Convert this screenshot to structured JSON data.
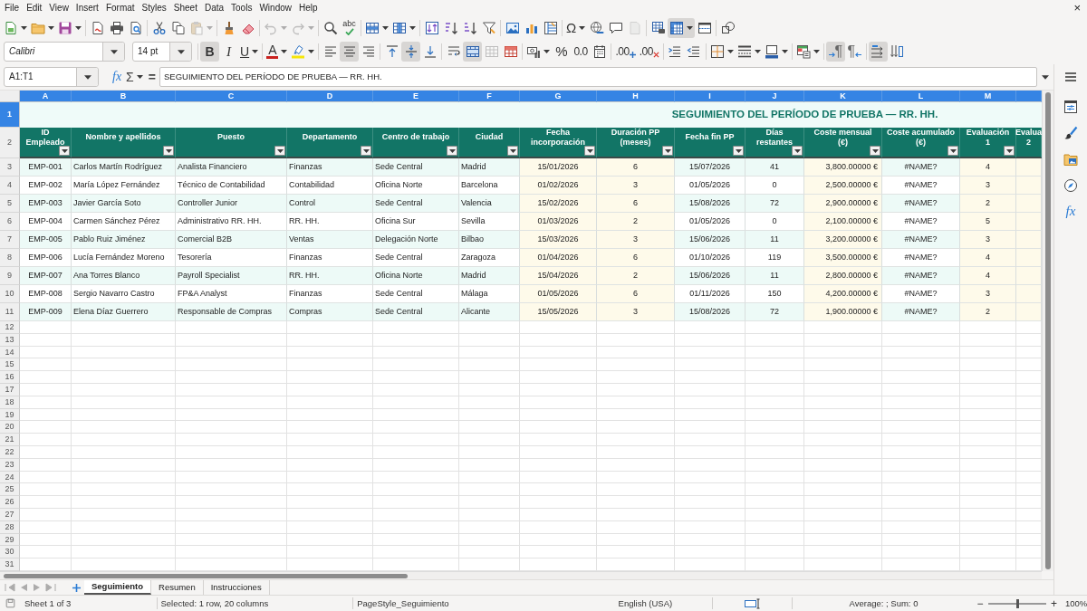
{
  "menu": [
    "File",
    "Edit",
    "View",
    "Insert",
    "Format",
    "Styles",
    "Sheet",
    "Data",
    "Tools",
    "Window",
    "Help"
  ],
  "close_document": "×",
  "standard_toolbar": {
    "paste": {
      "disabled": true
    },
    "undo": {
      "disabled": true
    },
    "redo": {
      "disabled": true
    },
    "spelling": {
      "label": "abc"
    },
    "special_character": {
      "label": "Ω"
    },
    "headers_footers": {
      "disabled": true
    },
    "freeze_panes": {
      "pressed": true
    }
  },
  "formatting_toolbar": {
    "font_name": "Calibri",
    "font_size": "14 pt",
    "bold": {
      "label": "B",
      "pressed": true
    },
    "italic": {
      "label": "I",
      "pressed": false
    },
    "underline": {
      "label": "U",
      "pressed": false
    },
    "font_color": {
      "label": "A"
    },
    "align_left": {
      "pressed": false
    },
    "align_center": {
      "pressed": true
    },
    "align_right": {
      "pressed": false
    },
    "align_top": {
      "pressed": false
    },
    "align_middle": {
      "pressed": true
    },
    "align_bottom": {
      "pressed": false
    },
    "wrap_text": {
      "pressed": false
    },
    "merge_and_center": {
      "pressed": true
    },
    "merge_cells": {
      "disabled": true
    },
    "percent": {
      "label": "%"
    },
    "standard_format": {
      "label": "0.0"
    },
    "add_decimal": {
      "label": ".00"
    },
    "delete_decimal": {
      "label": ".00"
    },
    "left_to_right": {
      "label": "¶",
      "pressed": true
    },
    "right_to_left": {
      "label": "¶",
      "pressed": false
    },
    "text_left_to_right": {
      "pressed": true
    },
    "text_vertical": {
      "pressed": false
    }
  },
  "formula_bar": {
    "name_box": "A1:T1",
    "function_wizard": "fx",
    "sum": "Σ",
    "formula": "=",
    "content": "SEGUIMIENTO DEL PERÍODO DE PRUEBA — RR. HH."
  },
  "sidebar": {
    "functions": "fx"
  },
  "sheet": {
    "columns": [
      {
        "letter": "A",
        "selected": true,
        "heading": "ID\nEmpleado",
        "kind": "key",
        "filter": true
      },
      {
        "letter": "B",
        "selected": true,
        "heading": "Nombre y apellidos",
        "kind": "text",
        "filter": true
      },
      {
        "letter": "C",
        "selected": true,
        "heading": "Puesto",
        "kind": "text",
        "filter": true
      },
      {
        "letter": "D",
        "selected": true,
        "heading": "Departamento",
        "kind": "text",
        "filter": true
      },
      {
        "letter": "E",
        "selected": true,
        "heading": "Centro de trabajo",
        "kind": "text",
        "filter": true
      },
      {
        "letter": "F",
        "selected": true,
        "heading": "Ciudad",
        "kind": "text",
        "filter": true
      },
      {
        "letter": "G",
        "selected": true,
        "heading": "Fecha\nincorporación",
        "kind": "input",
        "filter": true
      },
      {
        "letter": "H",
        "selected": true,
        "heading": "Duración PP\n(meses)",
        "kind": "input",
        "filter": true
      },
      {
        "letter": "I",
        "selected": true,
        "heading": "Fecha fin PP",
        "kind": "calc",
        "filter": true
      },
      {
        "letter": "J",
        "selected": true,
        "heading": "Días\nrestantes",
        "kind": "calc",
        "filter": true
      },
      {
        "letter": "K",
        "selected": true,
        "heading": "Coste mensual\n(€)",
        "kind": "money",
        "filter": true
      },
      {
        "letter": "L",
        "selected": true,
        "heading": "Coste acumulado\n(€)",
        "kind": "calc",
        "filter": true
      },
      {
        "letter": "M",
        "selected": true,
        "heading": "Evaluación\n1",
        "kind": "input",
        "filter": true
      },
      {
        "selected": true,
        "heading": "Evalua\n2",
        "kind": "input"
      }
    ],
    "title_row": {
      "number": "1",
      "selected": true,
      "title": "SEGUIMIENTO DEL PERÍODO DE PRUEBA — RR. HH."
    },
    "header_row": {
      "number": "2",
      "selected": false
    },
    "rows": [
      {
        "number": "3",
        "selected": false,
        "cells": [
          "EMP-001",
          "Carlos Martín Rodríguez",
          "Analista Financiero",
          "Finanzas",
          "Sede Central",
          "Madrid",
          "15/01/2026",
          "6",
          "15/07/2026",
          "41",
          "3,800.00000 €",
          "#NAME?",
          "4"
        ]
      },
      {
        "number": "4",
        "selected": false,
        "cells": [
          "EMP-002",
          "María López Fernández",
          "Técnico de Contabilidad",
          "Contabilidad",
          "Oficina Norte",
          "Barcelona",
          "01/02/2026",
          "3",
          "01/05/2026",
          "0",
          "2,500.00000 €",
          "#NAME?",
          "3"
        ]
      },
      {
        "number": "5",
        "selected": false,
        "cells": [
          "EMP-003",
          "Javier García Soto",
          "Controller Junior",
          "Control",
          "Sede Central",
          "Valencia",
          "15/02/2026",
          "6",
          "15/08/2026",
          "72",
          "2,900.00000 €",
          "#NAME?",
          "2"
        ]
      },
      {
        "number": "6",
        "selected": false,
        "cells": [
          "EMP-004",
          "Carmen Sánchez Pérez",
          "Administrativo RR. HH.",
          "RR. HH.",
          "Oficina Sur",
          "Sevilla",
          "01/03/2026",
          "2",
          "01/05/2026",
          "0",
          "2,100.00000 €",
          "#NAME?",
          "5"
        ]
      },
      {
        "number": "7",
        "selected": false,
        "cells": [
          "EMP-005",
          "Pablo Ruiz Jiménez",
          "Comercial B2B",
          "Ventas",
          "Delegación Norte",
          "Bilbao",
          "15/03/2026",
          "3",
          "15/06/2026",
          "11",
          "3,200.00000 €",
          "#NAME?",
          "3"
        ]
      },
      {
        "number": "8",
        "selected": false,
        "cells": [
          "EMP-006",
          "Lucía Fernández Moreno",
          "Tesorería",
          "Finanzas",
          "Sede Central",
          "Zaragoza",
          "01/04/2026",
          "6",
          "01/10/2026",
          "119",
          "3,500.00000 €",
          "#NAME?",
          "4"
        ]
      },
      {
        "number": "9",
        "selected": false,
        "cells": [
          "EMP-007",
          "Ana Torres Blanco",
          "Payroll Specialist",
          "RR. HH.",
          "Oficina Norte",
          "Madrid",
          "15/04/2026",
          "2",
          "15/06/2026",
          "11",
          "2,800.00000 €",
          "#NAME?",
          "4"
        ]
      },
      {
        "number": "10",
        "selected": false,
        "cells": [
          "EMP-008",
          "Sergio Navarro Castro",
          "FP&A Analyst",
          "Finanzas",
          "Sede Central",
          "Málaga",
          "01/05/2026",
          "6",
          "01/11/2026",
          "150",
          "4,200.00000 €",
          "#NAME?",
          "3"
        ]
      },
      {
        "number": "11",
        "selected": false,
        "cells": [
          "EMP-009",
          "Elena Díaz Guerrero",
          "Responsable de Compras",
          "Compras",
          "Sede Central",
          "Alicante",
          "15/05/2026",
          "3",
          "15/08/2026",
          "72",
          "1,900.00000 €",
          "#NAME?",
          "2"
        ]
      }
    ],
    "empty_rows": [
      {
        "number": "12",
        "selected": false
      },
      {
        "number": "13",
        "selected": false
      },
      {
        "number": "14",
        "selected": false
      },
      {
        "number": "15",
        "selected": false
      },
      {
        "number": "16",
        "selected": false
      },
      {
        "number": "17",
        "selected": false
      },
      {
        "number": "18",
        "selected": false
      },
      {
        "number": "19",
        "selected": false
      },
      {
        "number": "20",
        "selected": false
      },
      {
        "number": "21",
        "selected": false
      },
      {
        "number": "22",
        "selected": false
      },
      {
        "number": "23",
        "selected": false
      },
      {
        "number": "24",
        "selected": false
      },
      {
        "number": "25",
        "selected": false
      },
      {
        "number": "26",
        "selected": false
      },
      {
        "number": "27",
        "selected": false
      },
      {
        "number": "28",
        "selected": false
      },
      {
        "number": "29",
        "selected": false
      },
      {
        "number": "30",
        "selected": false
      },
      {
        "number": "31",
        "selected": false
      }
    ]
  },
  "sheet_tabs": [
    {
      "label": "Seguimiento",
      "selected": true
    },
    {
      "label": "Resumen",
      "selected": false
    },
    {
      "label": "Instrucciones",
      "selected": false
    }
  ],
  "status_bar": {
    "sheet": "Sheet 1 of 3",
    "selection": "Selected: 1 row, 20 columns",
    "page_style": "PageStyle_Seguimiento",
    "language": "English (USA)",
    "statistics": "Average: ; Sum: 0",
    "zoom_out": "−",
    "zoom": {
      "level": 0.5
    },
    "zoom_in": "+",
    "zoom_percent": "100%"
  }
}
